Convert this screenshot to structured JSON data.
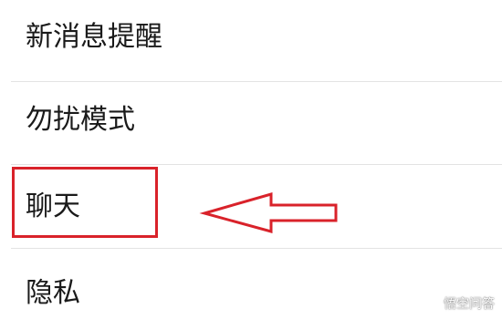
{
  "settings": {
    "items": [
      {
        "label": "新消息提醒"
      },
      {
        "label": "勿扰模式"
      },
      {
        "label": "聊天"
      },
      {
        "label": "隐私"
      }
    ]
  },
  "annotation": {
    "highlight_color": "#d9222a",
    "arrow_direction": "left",
    "highlighted_item": "聊天"
  },
  "watermark": {
    "icon": "camera-logo-icon",
    "text": "悟空问答"
  }
}
